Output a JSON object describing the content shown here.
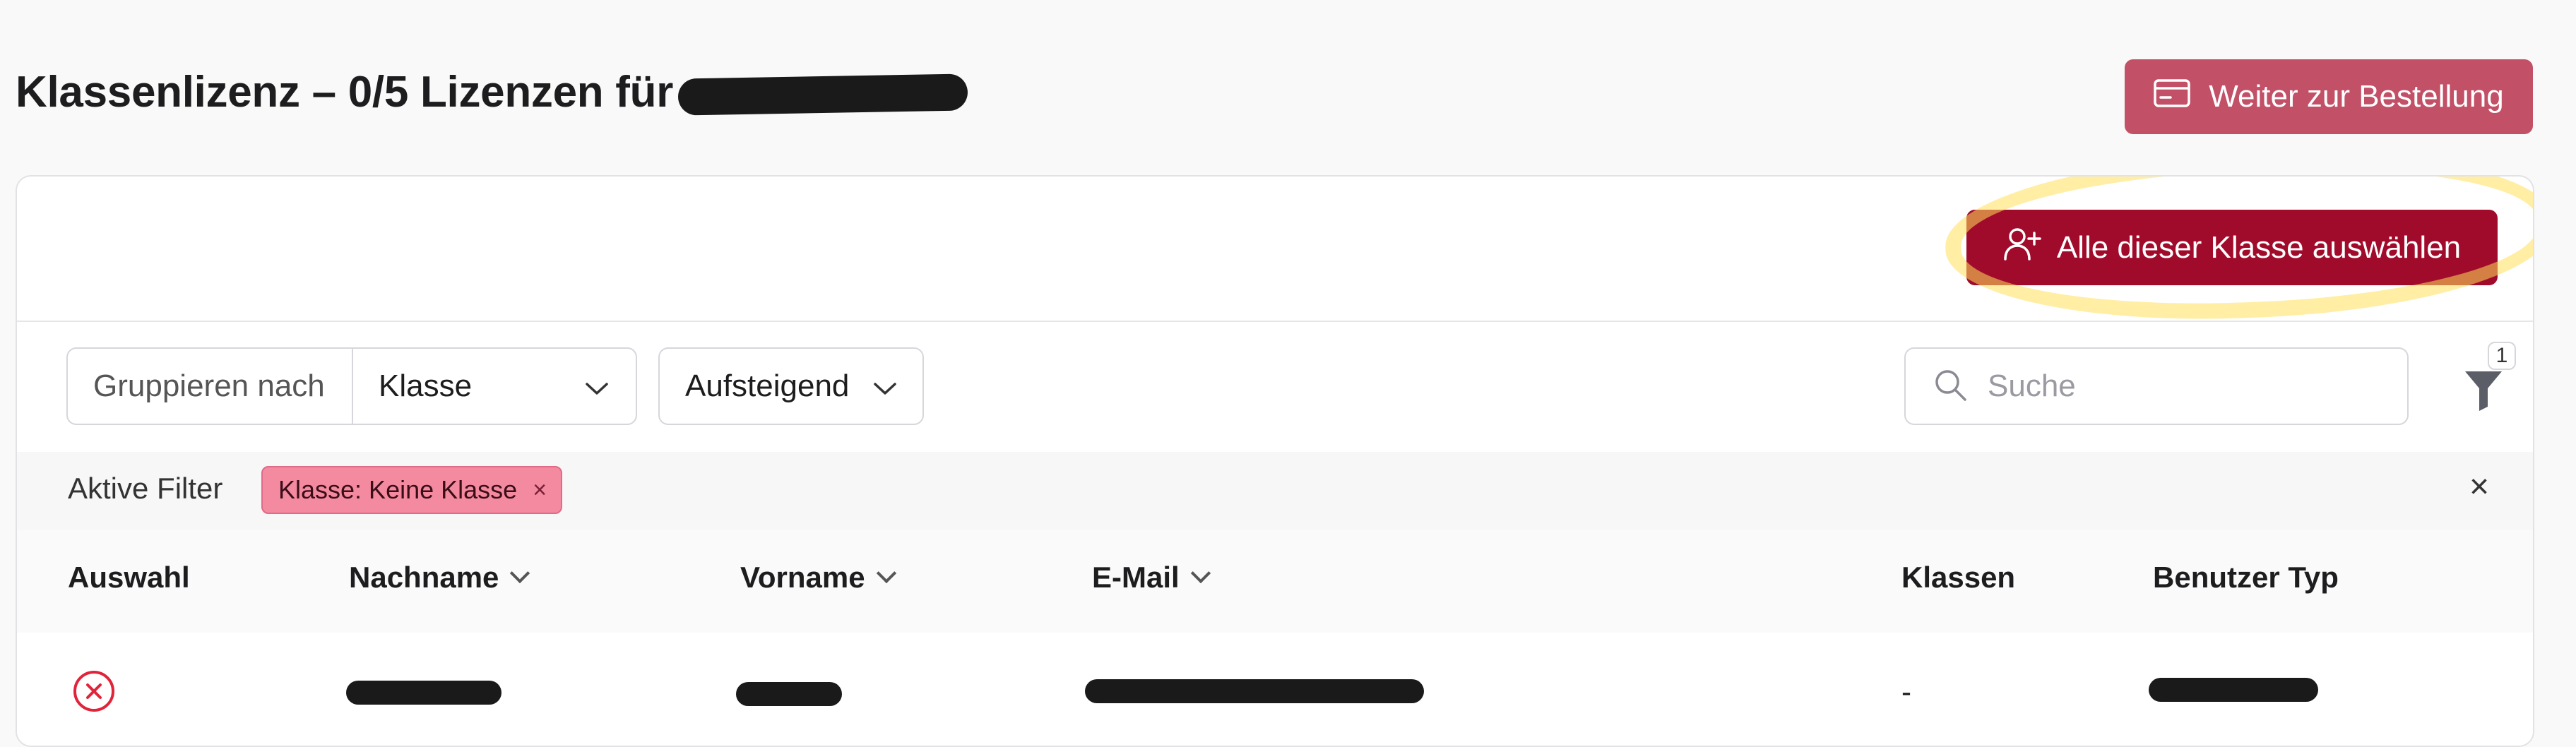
{
  "header": {
    "title": "Klassenlizenz – 0/5 Lizenzen für",
    "order_button": "Weiter zur Bestellung"
  },
  "actions": {
    "select_all_button": "Alle dieser Klasse auswählen"
  },
  "toolbar": {
    "group_by_label": "Gruppieren nach",
    "group_by_value": "Klasse",
    "sort_value": "Aufsteigend",
    "search_placeholder": "Suche",
    "filter_count": "1"
  },
  "active_filters": {
    "label": "Aktive Filter",
    "chips": [
      {
        "label": "Klasse: Keine Klasse",
        "remove": "×"
      }
    ],
    "clear": "×"
  },
  "table": {
    "columns": [
      "Auswahl",
      "Nachname",
      "Vorname",
      "E-Mail",
      "Klassen",
      "Benutzer Typ"
    ],
    "rows": [
      {
        "klassen": "-"
      }
    ]
  },
  "colors": {
    "primary": "#a10b2b",
    "order_button": "#c25067",
    "chip": "#f38aa0",
    "status_red": "#e0243a"
  },
  "icons": {
    "order_button": "credit-card-icon",
    "select_all": "user-plus-icon",
    "search": "search-icon",
    "filter": "filter-icon",
    "row_selection": "circle-x-icon"
  }
}
